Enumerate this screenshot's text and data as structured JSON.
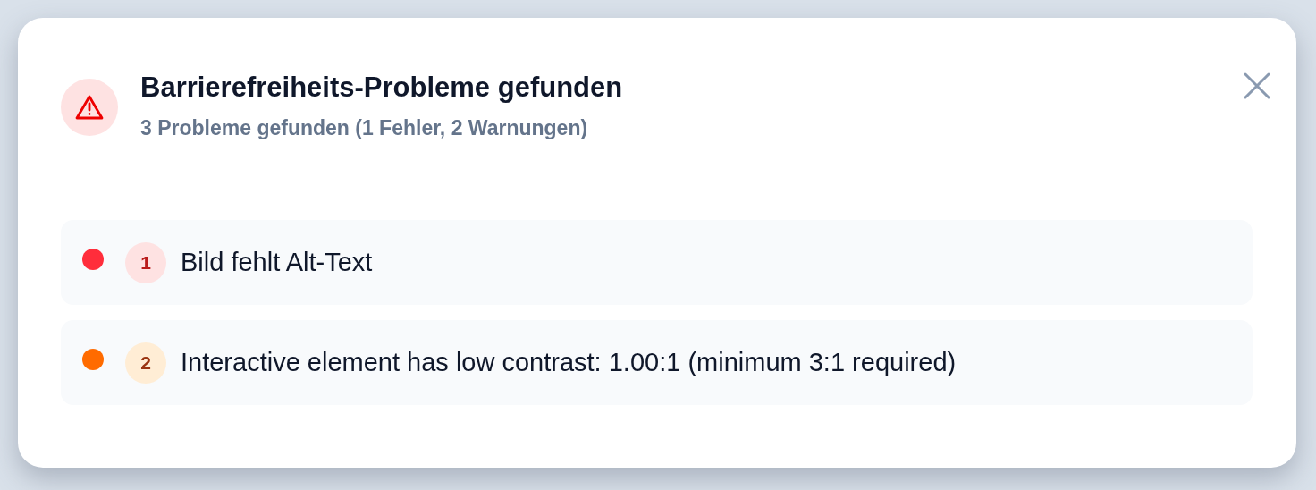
{
  "dialog": {
    "title": "Barrierefreiheits-Probleme gefunden",
    "subtitle": "3 Probleme gefunden (1 Fehler, 2 Warnungen)"
  },
  "issues": [
    {
      "number": "1",
      "kind": "error",
      "color": "#ff2d3b",
      "message": "Bild fehlt Alt-Text"
    },
    {
      "number": "2",
      "kind": "warning",
      "color": "#ff6b00",
      "message": "Interactive element has low contrast: 1.00:1 (minimum 3:1 required)"
    }
  ]
}
